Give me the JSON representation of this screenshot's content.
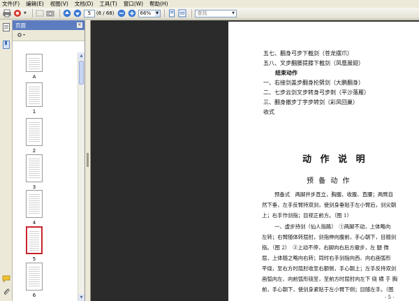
{
  "menu": [
    "文件(F)",
    "编辑(E)",
    "视图(V)",
    "文档(D)",
    "工具(T)",
    "窗口(W)",
    "帮助(H)"
  ],
  "toolbar": {
    "page_value": "5",
    "page_count": "(6 / 68)",
    "zoom_value": "66%",
    "search_placeholder": "查找"
  },
  "sidebar": {
    "panel_title": "页面",
    "thumbnails": [
      {
        "label": "A"
      },
      {
        "label": "1"
      },
      {
        "label": "2"
      },
      {
        "label": "3"
      },
      {
        "label": "4"
      },
      {
        "label": "5",
        "selected": true
      },
      {
        "label": "6"
      }
    ]
  },
  "document": {
    "toc_lines": [
      "五七、翻身弓步下截剑（苍龙摆爪）",
      "五八、叉步翻腰提膝下截剑（凤凰展翅）",
      "结束动作",
      "一、右接剑盖步翻身抡劈剑（大鹏翻身）",
      "二、七步云剑叉步转身弓步刺（平沙落雁）",
      "三、翻身撤步丁字步转剑（彩凤回巢）",
      "收式"
    ],
    "section_title": "动 作 说 明",
    "section_subtitle": "预 备 动 作",
    "paragraph1": [
      "预备式　两脚并步直立，胸腹、收腹、直腰；两臂自",
      "然下垂，左手反臂持双剑，使剑身垂贴于左小臂后，剑尖朝",
      "上；右手作剑指；目视正前方。（图 1）"
    ],
    "paragraph2": [
      "一、虚步持剑（仙人指路）　①两脚不动，上体略向",
      "左转；右臂随体转屈肘，剑指伸向腹前，手心朝下，目随剑",
      "指。（图 2）　②上动不停，右脚向右后方撤步，左 腿 微",
      "屈，上体随之略向右转；同时右手剑指向西、向右画弧形",
      "平绕，至右方时屈肘收至右额侧，手心朝上；左手反持双剑",
      "画弧向左、向前弧形绕至，至前方时屈肘向左下 绕 横 于 胸",
      "前，手心朝下，使剑身紧贴于左小臂下侧；目随左手。（图"
    ],
    "page_number": "· 5 ·"
  }
}
